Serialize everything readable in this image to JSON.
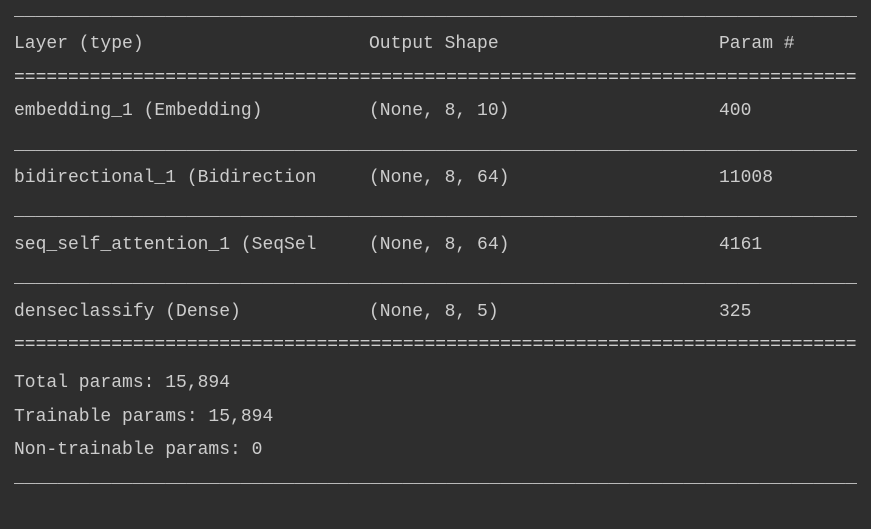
{
  "chart_data": {
    "type": "table",
    "title": "",
    "columns": [
      "Layer (type)",
      "Output Shape",
      "Param #"
    ],
    "rows": [
      {
        "layer": "embedding_1 (Embedding)",
        "output_shape": "(None, 8, 10)",
        "params": "400"
      },
      {
        "layer": "bidirectional_1 (Bidirection",
        "output_shape": "(None, 8, 64)",
        "params": "11008"
      },
      {
        "layer": "seq_self_attention_1 (SeqSel",
        "output_shape": "(None, 8, 64)",
        "params": "4161"
      },
      {
        "layer": "denseclassify (Dense)",
        "output_shape": "(None, 8, 5)",
        "params": "325"
      }
    ]
  },
  "headers": {
    "layer": "Layer (type)",
    "output": "Output Shape",
    "param": "Param #"
  },
  "rows": [
    {
      "layer": "embedding_1 (Embedding)",
      "output": "(None, 8, 10)",
      "param": "400"
    },
    {
      "layer": "bidirectional_1 (Bidirection",
      "output": "(None, 8, 64)",
      "param": "11008"
    },
    {
      "layer": "seq_self_attention_1 (SeqSel",
      "output": "(None, 8, 64)",
      "param": "4161"
    },
    {
      "layer": "denseclassify (Dense)",
      "output": "(None, 8, 5)",
      "param": "325"
    }
  ],
  "summary": {
    "total": "Total params: 15,894",
    "trainable": "Trainable params: 15,894",
    "non_trainable": "Non-trainable params: 0"
  },
  "dividers": {
    "dashed": "_________________________________________________________________________________",
    "double": "================================================================================="
  }
}
